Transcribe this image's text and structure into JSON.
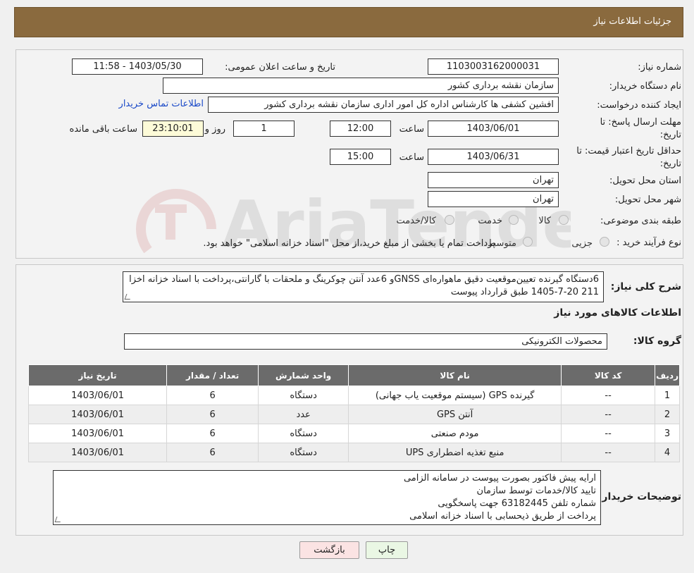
{
  "header": {
    "title": "جزئیات اطلاعات نیاز"
  },
  "form": {
    "need_number_label": "شماره نیاز:",
    "need_number": "1103003162000031",
    "announce_label": "تاریخ و ساعت اعلان عمومی:",
    "announce_value": "1403/05/30 - 11:58",
    "buyer_org_label": "نام دستگاه خریدار:",
    "buyer_org": "سازمان نقشه برداری کشور",
    "creator_label": "ایجاد کننده درخواست:",
    "creator": "افشین کشفی ها کارشناس اداره کل امور اداری سازمان نقشه برداری کشور",
    "contact_link": "اطلاعات تماس خریدار",
    "deadline_label_1": "مهلت ارسال پاسخ: تا",
    "deadline_label_2": "تاریخ:",
    "deadline_date": "1403/06/01",
    "time_label": "ساعت",
    "deadline_time": "12:00",
    "days_value": "1",
    "days_label": "روز و",
    "remaining_value": "23:10:01",
    "remaining_label": "ساعت باقی مانده",
    "validity_label_1": "حداقل تاریخ اعتبار قیمت: تا",
    "validity_label_2": "تاریخ:",
    "validity_date": "1403/06/31",
    "validity_time": "15:00",
    "province_label": "استان محل تحویل:",
    "province": "تهران",
    "city_label": "شهر محل تحویل:",
    "city": "تهران",
    "category_label": "طبقه بندی موضوعی:",
    "category_options": [
      "کالا",
      "خدمت",
      "کالا/خدمت"
    ],
    "process_label": "نوع فرآیند خرید :",
    "process_options": [
      "جزیی",
      "متوسط"
    ],
    "process_note": "پرداخت تمام یا بخشی از مبلغ خرید،از محل \"اسناد خزانه اسلامی\" خواهد بود."
  },
  "description": {
    "label": "شرح کلی نیاز:",
    "text": "6دستگاه گیرنده تعیین‌موقعیت دقیق ماهواره‌ای GNSSو 6عدد آنتن چوکرینگ و ملحقات با گارانتی،پرداخت با اسناد خزانه اخزا 211  20-7-1405 طبق قرارداد پیوست"
  },
  "goods_section": {
    "title": "اطلاعات کالاهای مورد نیاز",
    "group_label": "گروه کالا:",
    "group_value": "محصولات الکترونیکی"
  },
  "table": {
    "headers": [
      "ردیف",
      "کد کالا",
      "نام کالا",
      "واحد شمارش",
      "تعداد / مقدار",
      "تاریخ نیاز"
    ],
    "rows": [
      [
        "1",
        "--",
        "گیرنده GPS (سیستم موقعیت یاب جهانی)",
        "دستگاه",
        "6",
        "1403/06/01"
      ],
      [
        "2",
        "--",
        "آنتن GPS",
        "عدد",
        "6",
        "1403/06/01"
      ],
      [
        "3",
        "--",
        "مودم صنعتی",
        "دستگاه",
        "6",
        "1403/06/01"
      ],
      [
        "4",
        "--",
        "منبع تغذیه اضطراری UPS",
        "دستگاه",
        "6",
        "1403/06/01"
      ]
    ]
  },
  "buyer_notes": {
    "label": "توضیحات خریدار:",
    "lines": [
      "ارایه پیش فاکتور بصورت پیوست در سامانه الزامی",
      "تایید کالا/خدمات  توسط سازمان",
      "شماره تلفن 63182445 جهت پاسخگویی",
      "پرداخت از طریق ذیحسابی با اسناد خزانه اسلامی"
    ]
  },
  "buttons": {
    "print": "چاپ",
    "back": "بازگشت"
  },
  "colors": {
    "header": "#8a6a3e",
    "print_button": "#eaf7e4",
    "back_button": "#fbe3e3",
    "link": "#1a49c8"
  }
}
